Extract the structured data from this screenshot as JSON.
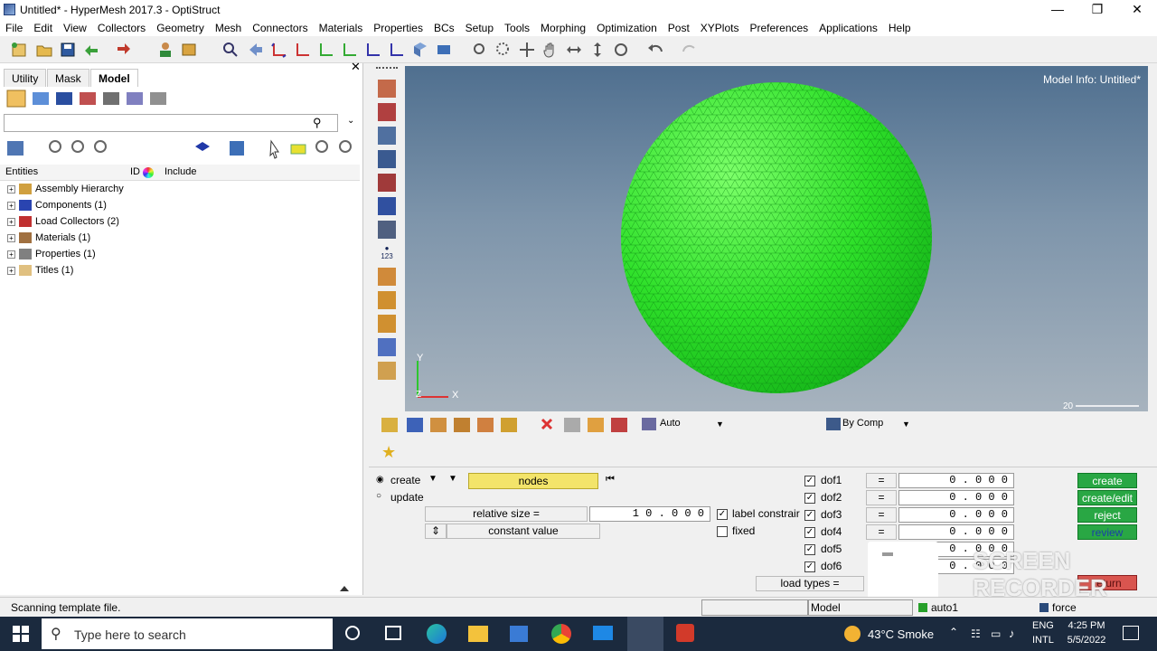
{
  "window": {
    "title": "Untitled* - HyperMesh 2017.3 - OptiStruct",
    "minimize": "—",
    "restore": "❐",
    "close": "✕"
  },
  "menu": [
    "File",
    "Edit",
    "View",
    "Collectors",
    "Geometry",
    "Mesh",
    "Connectors",
    "Materials",
    "Properties",
    "BCs",
    "Setup",
    "Tools",
    "Morphing",
    "Optimization",
    "Post",
    "XYPlots",
    "Preferences",
    "Applications",
    "Help"
  ],
  "left_panel": {
    "tabs": [
      {
        "label": "Utility",
        "active": false
      },
      {
        "label": "Mask",
        "active": false
      },
      {
        "label": "Model",
        "active": true
      }
    ],
    "columns": {
      "entities": "Entities",
      "id": "ID",
      "include": "Include"
    },
    "tree": [
      {
        "label": "Assembly Hierarchy",
        "icon": "assembly-icon"
      },
      {
        "label": "Components (1)",
        "icon": "component-icon"
      },
      {
        "label": "Load Collectors (2)",
        "icon": "load-collector-icon"
      },
      {
        "label": "Materials (1)",
        "icon": "material-icon"
      },
      {
        "label": "Properties (1)",
        "icon": "property-icon"
      },
      {
        "label": "Titles (1)",
        "icon": "title-icon"
      }
    ]
  },
  "viewport": {
    "info": "Model Info: Untitled*",
    "scale_label": "20",
    "axis": {
      "x": "X",
      "y": "Y",
      "z": "Z"
    },
    "mesh_color": "#22e62a",
    "background_top": "#4f6f8f",
    "background_bottom": "#a7b3be"
  },
  "bottom_toolbar": {
    "auto_label": "Auto",
    "bycomp_label": "By Comp"
  },
  "panel": {
    "create_radio": "create",
    "update_radio": "update",
    "entity_selector": "nodes",
    "relative_size_label": "relative size =",
    "relative_size_value": "1 0 . 0 0 0",
    "constant_value": "constant value",
    "label_constraints": "label constrair",
    "fixed": "fixed",
    "load_types_label": "load types =",
    "dofs": [
      {
        "label": "dof1",
        "checked": true,
        "eq": "=",
        "value": "0 . 0 0 0"
      },
      {
        "label": "dof2",
        "checked": true,
        "eq": "=",
        "value": "0 . 0 0 0"
      },
      {
        "label": "dof3",
        "checked": true,
        "eq": "=",
        "value": "0 . 0 0 0"
      },
      {
        "label": "dof4",
        "checked": true,
        "eq": "=",
        "value": "0 . 0 0 0"
      },
      {
        "label": "dof5",
        "checked": true,
        "value": "0 . 0 0 0"
      },
      {
        "label": "dof6",
        "checked": true,
        "value": "0 . 0 0 0"
      }
    ],
    "buttons": {
      "create": "create",
      "create_edit": "create/edit",
      "reject": "reject",
      "review": "review",
      "return": "return"
    }
  },
  "status": {
    "message": "Scanning template file.",
    "model": "Model",
    "component": "auto1",
    "load": "force"
  },
  "watermark": "SCREEN RECORDER",
  "taskbar": {
    "search_placeholder": "Type here to search",
    "weather": "43°C  Smoke",
    "lang_top": "ENG",
    "lang_bottom": "INTL",
    "time": "4:25 PM",
    "date": "5/5/2022"
  }
}
